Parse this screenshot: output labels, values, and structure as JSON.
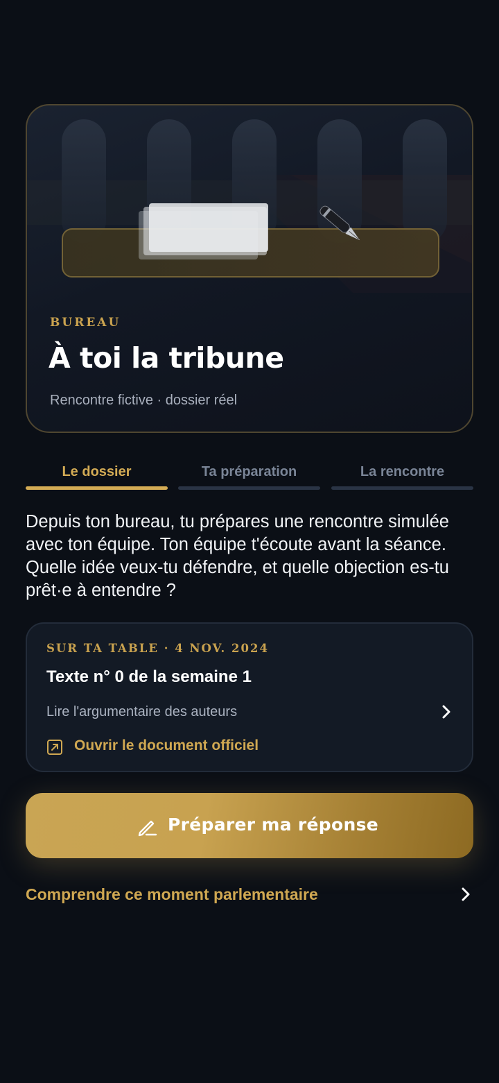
{
  "hero": {
    "kicker": "BUREAU",
    "title": "À toi la tribune",
    "subtitle": "Rencontre fictive · dossier réel"
  },
  "tabs": [
    {
      "label": "Le dossier",
      "active": true
    },
    {
      "label": "Ta préparation",
      "active": false
    },
    {
      "label": "La rencontre",
      "active": false
    }
  ],
  "intro": "Depuis ton bureau, tu prépares une rencontre simulée avec ton équipe. Ton équipe t'écoute avant la séance. Quelle idée veux-tu défendre, et quelle objection es-tu prêt·e à entendre ?",
  "dossier": {
    "kicker": "SUR TA TABLE · 4 NOV. 2024",
    "title": "Texte n° 0 de la semaine 1",
    "read_link": "Lire l'argumentaire des auteurs",
    "open_link": "Ouvrir le document officiel"
  },
  "cta": {
    "label": "Préparer ma réponse",
    "icon": "pen-icon"
  },
  "learn_more": "Comprendre ce moment parlementaire",
  "colors": {
    "accent": "#d4ac55",
    "background": "#0b0f16",
    "card": "#131a25"
  }
}
